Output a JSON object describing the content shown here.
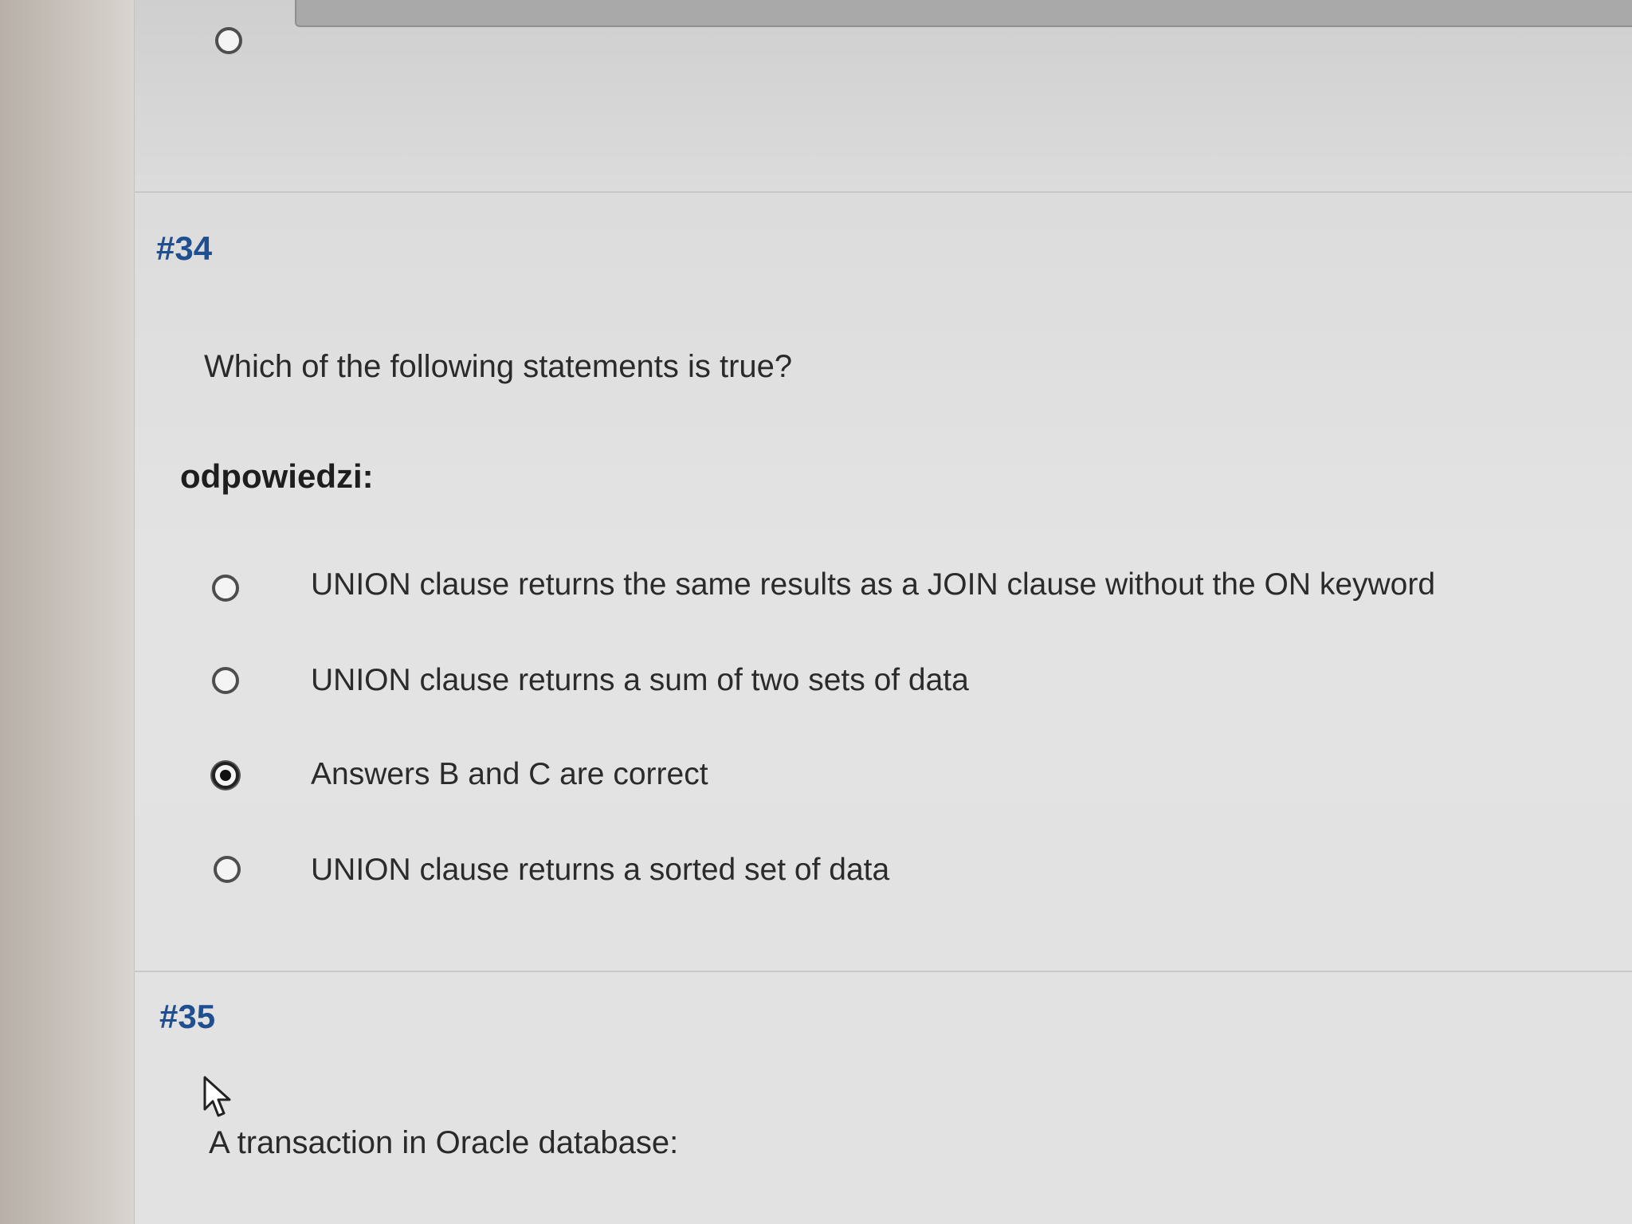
{
  "question_34": {
    "number": "#34",
    "text": "Which of the following statements is true?",
    "answers_label": "odpowiedzi:",
    "options": [
      {
        "label": "UNION clause returns the same results as a JOIN clause without the ON keyword",
        "selected": false
      },
      {
        "label": "UNION clause returns a sum of two sets of data",
        "selected": false
      },
      {
        "label": "Answers B and C are correct",
        "selected": true
      },
      {
        "label": "UNION clause returns a sorted set of data",
        "selected": false
      }
    ]
  },
  "question_35": {
    "number": "#35",
    "text": "A transaction in Oracle database:"
  },
  "previous_question": {
    "option_selected": false
  },
  "colors": {
    "question_number": "#1f4f91",
    "text": "#2b2b2b"
  }
}
